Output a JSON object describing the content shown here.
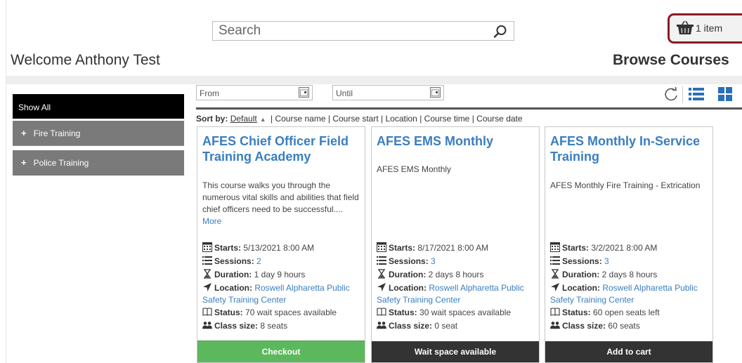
{
  "header": {
    "search_placeholder": "Search",
    "cart_count": "1 item",
    "welcome": "Welcome Anthony Test",
    "page_title": "Browse Courses"
  },
  "sidebar": {
    "items": [
      {
        "label": "Show All",
        "selected": true
      },
      {
        "label": "Fire Training",
        "prefix": "+"
      },
      {
        "label": "Police Training",
        "prefix": "+"
      }
    ]
  },
  "filters": {
    "from_placeholder": "From",
    "until_placeholder": "Until"
  },
  "sort": {
    "label": "Sort by:",
    "options": [
      "Default",
      "Course name",
      "Course start",
      "Location",
      "Course time",
      "Course date"
    ],
    "active": "Default",
    "separator": "|"
  },
  "meta_labels": {
    "starts": "Starts:",
    "sessions": "Sessions:",
    "duration": "Duration:",
    "location": "Location:",
    "status": "Status:",
    "class_size": "Class size:"
  },
  "courses": [
    {
      "title": "AFES Chief Officer Field Training Academy",
      "description": "This course walks you through the numerous vital skills and abilities that field chief officers need to be successful....",
      "more": "More",
      "starts": "5/13/2021 8:00 AM",
      "sessions": "2",
      "duration": "1 day 9 hours",
      "location": "Roswell Alpharetta Public Safety Training Center",
      "status": "70 wait spaces available",
      "class_size": "8 seats",
      "button": "Checkout",
      "button_color": "#5cb85c"
    },
    {
      "title": "AFES EMS Monthly",
      "description": "AFES EMS Monthly",
      "starts": "8/17/2021 8:00 AM",
      "sessions": "3",
      "duration": "2 days 8 hours",
      "location": "Roswell Alpharetta Public Safety Training Center",
      "status": "30 wait spaces available",
      "class_size": "0 seat",
      "button": "Wait space available",
      "button_color": "#333333"
    },
    {
      "title": "AFES Monthly In-Service Training",
      "description": "AFES Monthly Fire Training - Extrication",
      "starts": "3/2/2021 8:00 AM",
      "sessions": "3",
      "duration": "2 days 8 hours",
      "location": "Roswell Alpharetta Public Safety Training Center",
      "status": "60 open seats left",
      "class_size": "60 seats",
      "button": "Add to cart",
      "button_color": "#333333"
    }
  ],
  "colors": {
    "link": "#3a7ec0",
    "cart_border": "#8b1a22",
    "sidebar_active": "#000000",
    "sidebar_item": "#7a7a7a"
  }
}
